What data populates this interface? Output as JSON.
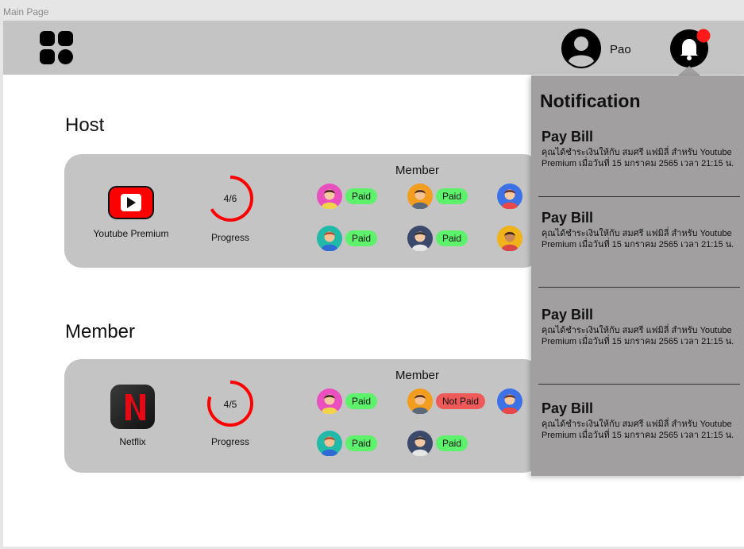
{
  "frame": {
    "title": "Main Page"
  },
  "header": {
    "username": "Pao",
    "icons": [
      "apps-grid-icon",
      "user-avatar-icon",
      "bell-icon"
    ],
    "bell_has_dot": true
  },
  "colors": {
    "topbar": "#c4c4c4",
    "card": "#c4c4c4",
    "notif_panel": "#a19f9f",
    "paid": "#5ef16b",
    "not_paid": "#ee5a5a",
    "progress": "#ff0000",
    "youtube": "#ff0000",
    "netflix": "#e50914"
  },
  "sections": {
    "host": {
      "title": "Host",
      "service": "Youtube Premium",
      "progress_text": "4/6",
      "progress_fraction": 0.667,
      "progress_label": "Progress",
      "members_heading": "Member",
      "members": [
        {
          "avatar": "girl-pink-avatar-icon",
          "status": "Paid"
        },
        {
          "avatar": "boy-orange-avatar-icon",
          "status": "Paid"
        },
        {
          "avatar": "girl-blue-avatar-icon",
          "status": ""
        },
        {
          "avatar": "boy-teal-avatar-icon",
          "status": "Paid"
        },
        {
          "avatar": "man-grey-avatar-icon",
          "status": "Paid"
        },
        {
          "avatar": "woman-yellow-avatar-icon",
          "status": ""
        }
      ]
    },
    "member": {
      "title": "Member",
      "service": "Netflix",
      "progress_text": "4/5",
      "progress_fraction": 0.8,
      "progress_label": "Progress",
      "members_heading": "Member",
      "members": [
        {
          "avatar": "girl-pink-avatar-icon",
          "status": "Paid"
        },
        {
          "avatar": "boy-orange-avatar-icon",
          "status": "Not Paid"
        },
        {
          "avatar": "girl-blue-avatar-icon",
          "status": ""
        },
        {
          "avatar": "boy-teal-avatar-icon",
          "status": "Paid"
        },
        {
          "avatar": "man-grey-avatar-icon",
          "status": "Paid"
        }
      ]
    }
  },
  "notification": {
    "title": "Notification",
    "items": [
      {
        "heading": "Pay Bill",
        "body": "คุณได้ชำระเงินให้กับ สมศรี แฟมิลี่ สำหรับ Youtube Premium เมื่อวันที่ 15 มกราคม 2565 เวลา 21:15 น."
      },
      {
        "heading": "Pay Bill",
        "body": "คุณได้ชำระเงินให้กับ สมศรี แฟมิลี่ สำหรับ Youtube Premium เมื่อวันที่ 15 มกราคม 2565 เวลา 21:15 น."
      },
      {
        "heading": "Pay Bill",
        "body": "คุณได้ชำระเงินให้กับ สมศรี แฟมิลี่ สำหรับ Youtube Premium เมื่อวันที่ 15 มกราคม 2565 เวลา 21:15 น."
      },
      {
        "heading": "Pay Bill",
        "body": "คุณได้ชำระเงินให้กับ สมศรี แฟมิลี่ สำหรับ Youtube Premium เมื่อวันที่ 15 มกราคม 2565 เวลา 21:15 น."
      }
    ]
  }
}
